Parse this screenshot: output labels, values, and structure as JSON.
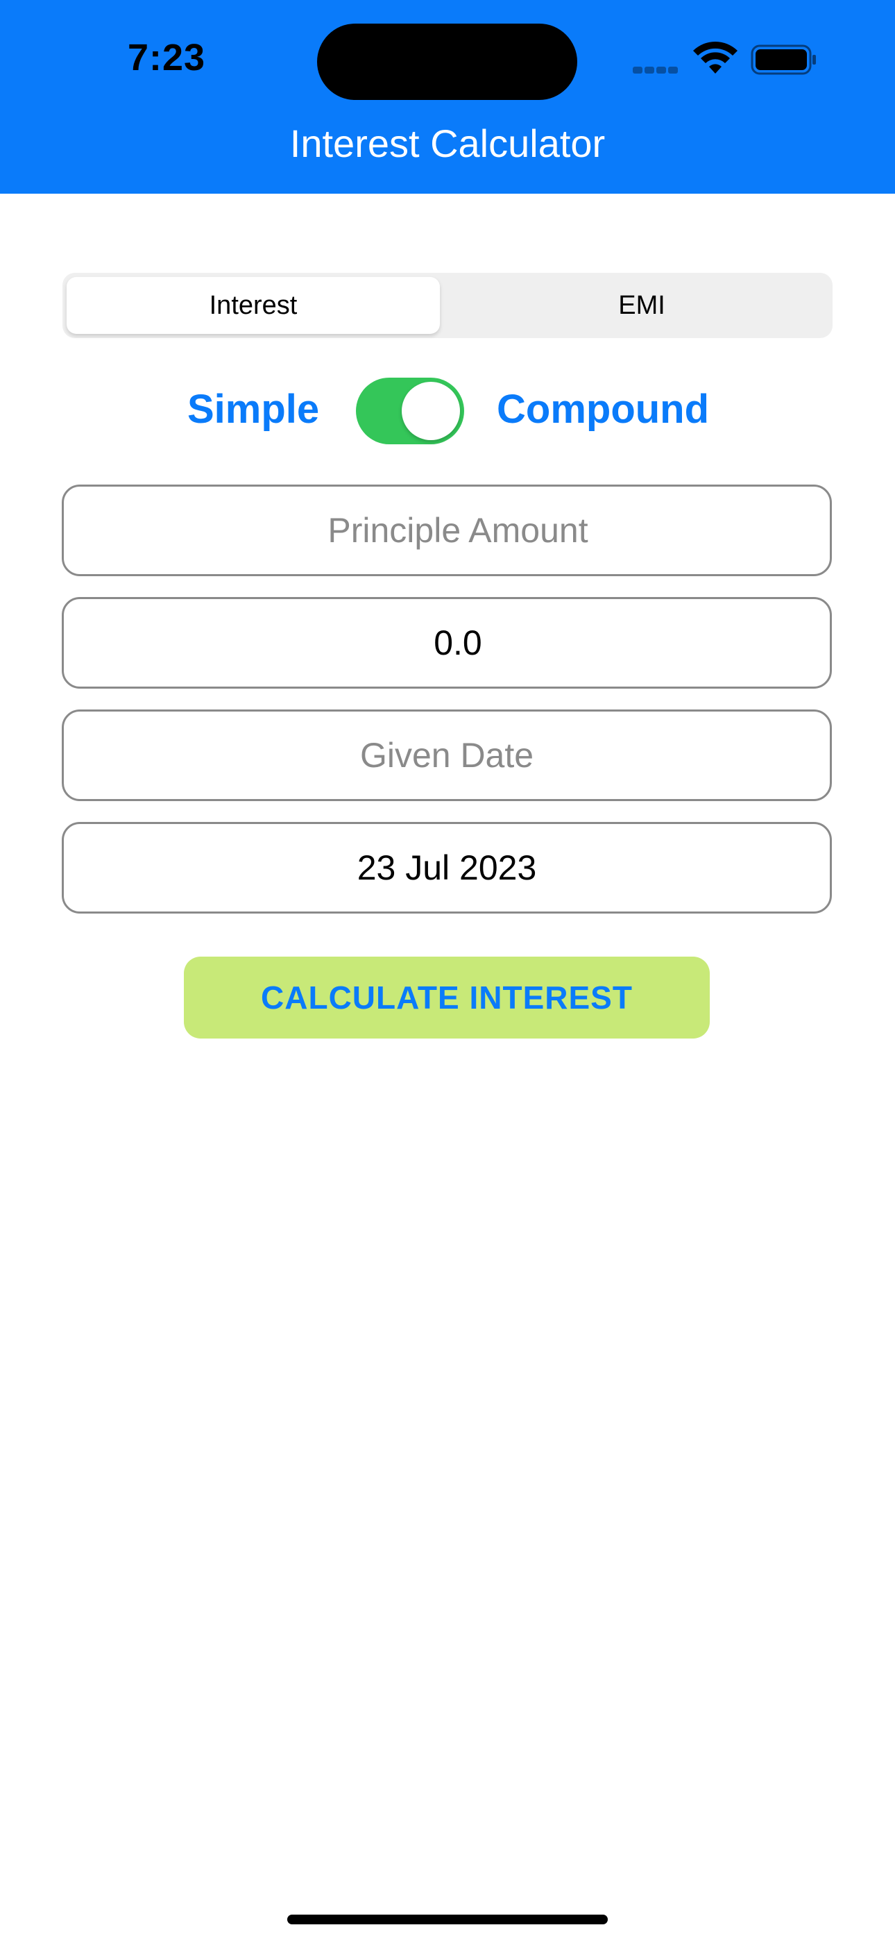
{
  "status_bar": {
    "time": "7:23"
  },
  "header": {
    "title": "Interest Calculator",
    "background_color": "#0a7bfa"
  },
  "segmented_control": {
    "segments": [
      {
        "label": "Interest",
        "selected": true
      },
      {
        "label": "EMI",
        "selected": false
      }
    ]
  },
  "toggle": {
    "left_label": "Simple",
    "right_label": "Compound",
    "on": true,
    "on_color": "#34c659"
  },
  "fields": {
    "principle_amount": {
      "value": "",
      "placeholder": "Principle Amount"
    },
    "rate": {
      "value": "0.0"
    },
    "given_date": {
      "value": "",
      "placeholder": "Given Date"
    },
    "end_date": {
      "value": "23 Jul 2023"
    }
  },
  "calculate_button": {
    "label": "CALCULATE INTEREST",
    "background_color": "#c8e978",
    "text_color": "#0a7bfa"
  },
  "icons": {
    "signal": "cellular-signal-icon",
    "wifi": "wifi-icon",
    "battery": "battery-icon"
  }
}
